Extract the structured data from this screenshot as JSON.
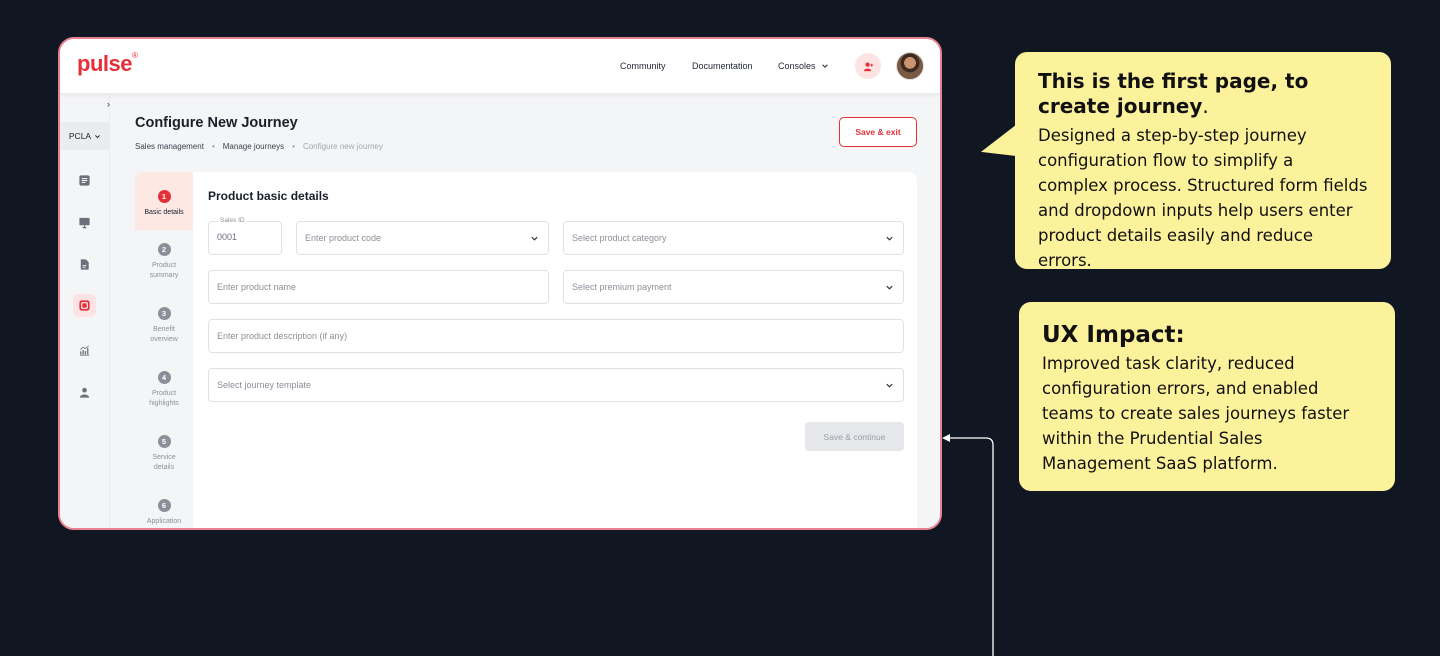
{
  "app": {
    "logo": "pulse",
    "nav": {
      "community": "Community",
      "documentation": "Documentation",
      "consoles": "Consoles"
    },
    "sidebar": {
      "org": "PCLA",
      "icons": [
        "list-icon",
        "monitor-icon",
        "document-icon",
        "journey-icon",
        "analytics-icon",
        "person-icon"
      ]
    },
    "page": {
      "title": "Configure New Journey",
      "breadcrumbs": [
        "Sales management",
        "Manage journeys",
        "Configure new journey"
      ],
      "save_exit": "Save & exit"
    },
    "steps": [
      {
        "num": "1",
        "label": "Basic details"
      },
      {
        "num": "2",
        "label": "Product summary"
      },
      {
        "num": "3",
        "label": "Benefit overview"
      },
      {
        "num": "4",
        "label": "Product highlights"
      },
      {
        "num": "5",
        "label": "Service details"
      },
      {
        "num": "6",
        "label": "Application"
      }
    ],
    "form": {
      "title": "Product basic details",
      "sales_id_label": "Sales ID",
      "sales_id_value": "0001",
      "product_code_placeholder": "Enter product code",
      "product_category_placeholder": "Select product category",
      "product_name_placeholder": "Enter product name",
      "premium_payment_placeholder": "Select premium payment",
      "description_placeholder": "Enter product description (if any)",
      "journey_template_placeholder": "Select journey template",
      "save_continue": "Save & continue"
    }
  },
  "callouts": {
    "first": {
      "title": "This is the first page, to create journey",
      "title_end": ".",
      "description": "Designed a step-by-step journey configuration flow to simplify a complex process. Structured form fields and dropdown inputs help users enter product details easily and reduce errors."
    },
    "second": {
      "title": "UX Impact:",
      "description": "Improved task clarity, reduced configuration errors, and enabled teams to create sales journeys faster within the Prudential Sales Management SaaS platform."
    }
  },
  "colors": {
    "background": "#111722",
    "accent": "#e5303a",
    "callout": "#fdf29c",
    "window_border": "#e8808d"
  }
}
